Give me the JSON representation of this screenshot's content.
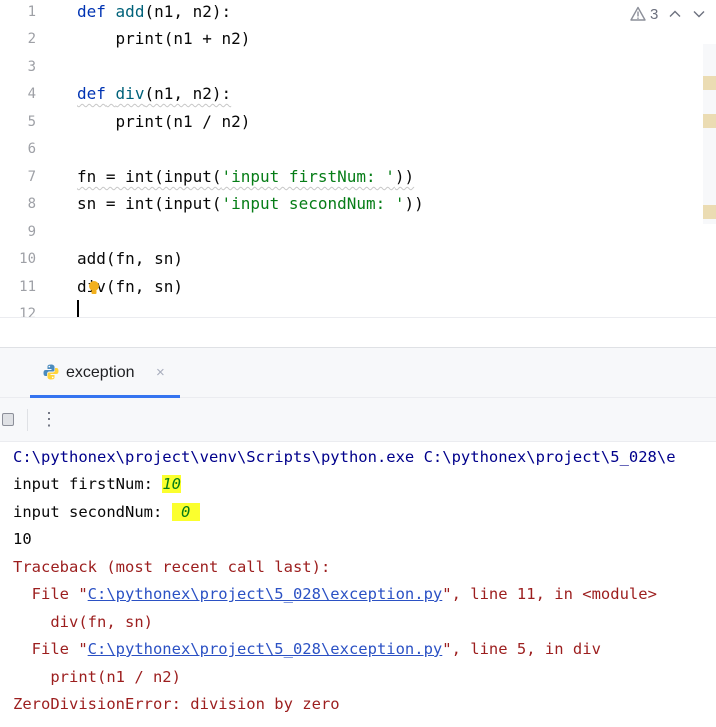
{
  "editor": {
    "line_numbers": [
      "1",
      "2",
      "3",
      "4",
      "5",
      "6",
      "7",
      "8",
      "9",
      "10",
      "11",
      "12"
    ],
    "inspection_count": "3"
  },
  "code": {
    "l1": {
      "kw": "def",
      "name": "add",
      "rest": "(n1, n2):"
    },
    "l2": {
      "indent": "    ",
      "text": "print(n1 + n2)"
    },
    "l4": {
      "kw": "def",
      "name": "div",
      "rest": "(n1, n2):"
    },
    "l5": {
      "indent": "    ",
      "text": "print(n1 / n2)"
    },
    "l7": {
      "pre": "fn = int(input(",
      "str": "'input firstNum: '",
      "post": "))"
    },
    "l8": {
      "pre": "sn = int(input(",
      "str": "'input secondNum: '",
      "post": "))"
    },
    "l10": {
      "text": "add(fn, sn)"
    },
    "l11": {
      "a": "d",
      "b": "iv",
      "rest": "(fn, sn)"
    }
  },
  "run": {
    "tab_label": "exception",
    "tab_close": "×",
    "more_label": "⋮"
  },
  "console": {
    "cmd": "C:\\pythonex\\project\\venv\\Scripts\\python.exe C:\\pythonex\\project\\5_028\\e",
    "prompt1": "input firstNum: ",
    "input1": "10",
    "prompt2": "input secondNum: ",
    "input2": " 0 ",
    "output": "10",
    "traceback": "Traceback (most recent call last):",
    "file1_pre": "  File \"",
    "file1_link": "C:\\pythonex\\project\\5_028\\exception.py",
    "file1_post": "\", line 11, in <module>",
    "file1_code": "    div(fn, sn)",
    "file2_pre": "  File \"",
    "file2_link": "C:\\pythonex\\project\\5_028\\exception.py",
    "file2_post": "\", line 5, in div",
    "file2_code": "    print(n1 / n2)",
    "error": "ZeroDivisionError: division by zero"
  },
  "colors": {
    "keyword": "#0033b3",
    "function_name": "#00627a",
    "string": "#067d17",
    "error_text": "#9c1e1e",
    "link": "#2b51c4",
    "highlight": "#fbff2e",
    "tab_accent": "#3574f0"
  },
  "icons": [
    "warning-icon",
    "chevron-up-icon",
    "chevron-down-icon",
    "bulb-icon",
    "python-icon",
    "stop-icon",
    "more-vertical-icon"
  ]
}
